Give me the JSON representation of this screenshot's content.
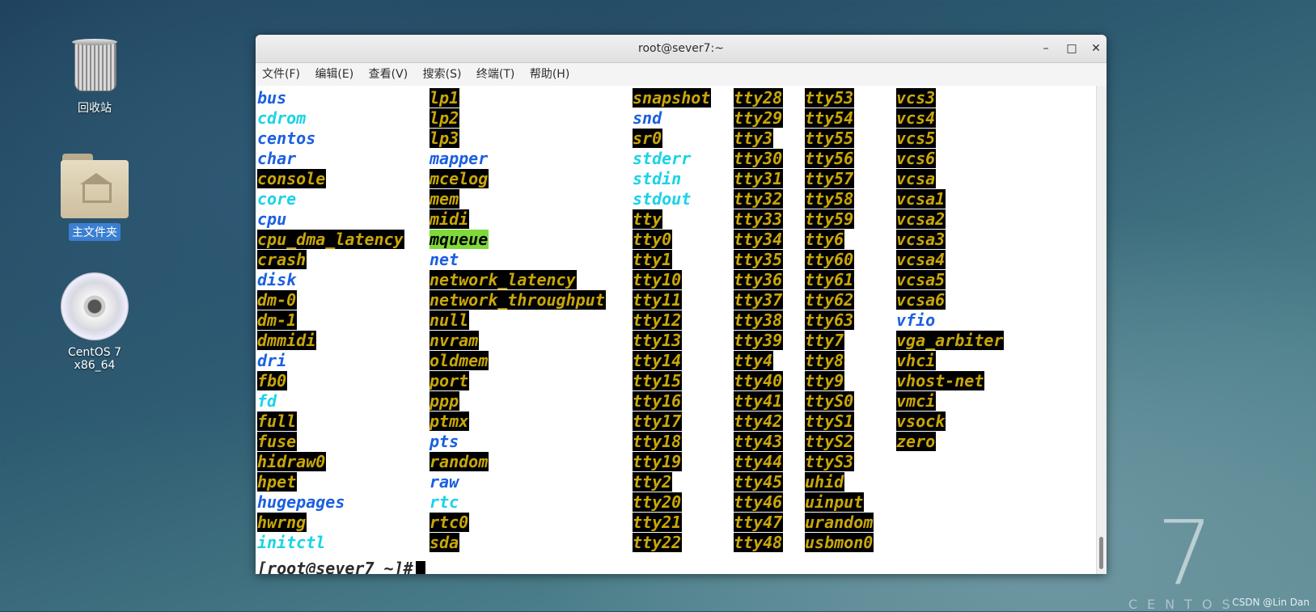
{
  "desktop": {
    "icons": [
      {
        "label": "回收站",
        "icon": "trash-icon"
      },
      {
        "label": "主文件夹",
        "icon": "home-folder-icon"
      },
      {
        "label": "CentOS 7 x86_64",
        "icon": "disc-icon"
      }
    ],
    "branding": {
      "number": "7",
      "word": "CENTOS"
    },
    "watermark": "CSDN @Lin Dan"
  },
  "window": {
    "title": "root@sever7:~",
    "controls": {
      "minimize": "–",
      "maximize": "□",
      "close": "✕"
    },
    "menu": [
      "文件(F)",
      "编辑(E)",
      "查看(V)",
      "搜索(S)",
      "终端(T)",
      "帮助(H)"
    ]
  },
  "terminal": {
    "colors": {
      "dir": "#1a5fe0",
      "link": "#19d3e6",
      "device": "#c9a70a",
      "sticky_bg": "#7fd93a"
    },
    "columns": [
      [
        {
          "name": "bus",
          "type": "dir"
        },
        {
          "name": "cdrom",
          "type": "link"
        },
        {
          "name": "centos",
          "type": "dir"
        },
        {
          "name": "char",
          "type": "dir"
        },
        {
          "name": "console",
          "type": "dev"
        },
        {
          "name": "core",
          "type": "link"
        },
        {
          "name": "cpu",
          "type": "dir"
        },
        {
          "name": "cpu_dma_latency",
          "type": "dev"
        },
        {
          "name": "crash",
          "type": "dev"
        },
        {
          "name": "disk",
          "type": "dir"
        },
        {
          "name": "dm-0",
          "type": "dev"
        },
        {
          "name": "dm-1",
          "type": "dev"
        },
        {
          "name": "dmmidi",
          "type": "dev"
        },
        {
          "name": "dri",
          "type": "dir"
        },
        {
          "name": "fb0",
          "type": "dev"
        },
        {
          "name": "fd",
          "type": "link"
        },
        {
          "name": "full",
          "type": "dev"
        },
        {
          "name": "fuse",
          "type": "dev"
        },
        {
          "name": "hidraw0",
          "type": "dev"
        },
        {
          "name": "hpet",
          "type": "dev"
        },
        {
          "name": "hugepages",
          "type": "dir"
        },
        {
          "name": "hwrng",
          "type": "dev"
        },
        {
          "name": "initctl",
          "type": "link"
        }
      ],
      [
        {
          "name": "lp1",
          "type": "dev"
        },
        {
          "name": "lp2",
          "type": "dev"
        },
        {
          "name": "lp3",
          "type": "dev"
        },
        {
          "name": "mapper",
          "type": "dir"
        },
        {
          "name": "mcelog",
          "type": "dev"
        },
        {
          "name": "mem",
          "type": "dev"
        },
        {
          "name": "midi",
          "type": "dev"
        },
        {
          "name": "mqueue",
          "type": "sticky"
        },
        {
          "name": "net",
          "type": "dir"
        },
        {
          "name": "network_latency",
          "type": "dev"
        },
        {
          "name": "network_throughput",
          "type": "dev"
        },
        {
          "name": "null",
          "type": "dev"
        },
        {
          "name": "nvram",
          "type": "dev"
        },
        {
          "name": "oldmem",
          "type": "dev"
        },
        {
          "name": "port",
          "type": "dev"
        },
        {
          "name": "ppp",
          "type": "dev"
        },
        {
          "name": "ptmx",
          "type": "dev"
        },
        {
          "name": "pts",
          "type": "dir"
        },
        {
          "name": "random",
          "type": "dev"
        },
        {
          "name": "raw",
          "type": "dir"
        },
        {
          "name": "rtc",
          "type": "link"
        },
        {
          "name": "rtc0",
          "type": "dev"
        },
        {
          "name": "sda",
          "type": "dev"
        }
      ],
      [
        {
          "name": "snapshot",
          "type": "dev"
        },
        {
          "name": "snd",
          "type": "dir"
        },
        {
          "name": "sr0",
          "type": "dev"
        },
        {
          "name": "stderr",
          "type": "link"
        },
        {
          "name": "stdin",
          "type": "link"
        },
        {
          "name": "stdout",
          "type": "link"
        },
        {
          "name": "tty",
          "type": "dev"
        },
        {
          "name": "tty0",
          "type": "dev"
        },
        {
          "name": "tty1",
          "type": "dev"
        },
        {
          "name": "tty10",
          "type": "dev"
        },
        {
          "name": "tty11",
          "type": "dev"
        },
        {
          "name": "tty12",
          "type": "dev"
        },
        {
          "name": "tty13",
          "type": "dev"
        },
        {
          "name": "tty14",
          "type": "dev"
        },
        {
          "name": "tty15",
          "type": "dev"
        },
        {
          "name": "tty16",
          "type": "dev"
        },
        {
          "name": "tty17",
          "type": "dev"
        },
        {
          "name": "tty18",
          "type": "dev"
        },
        {
          "name": "tty19",
          "type": "dev"
        },
        {
          "name": "tty2",
          "type": "dev"
        },
        {
          "name": "tty20",
          "type": "dev"
        },
        {
          "name": "tty21",
          "type": "dev"
        },
        {
          "name": "tty22",
          "type": "dev"
        }
      ],
      [
        {
          "name": "tty28",
          "type": "dev"
        },
        {
          "name": "tty29",
          "type": "dev"
        },
        {
          "name": "tty3",
          "type": "dev"
        },
        {
          "name": "tty30",
          "type": "dev"
        },
        {
          "name": "tty31",
          "type": "dev"
        },
        {
          "name": "tty32",
          "type": "dev"
        },
        {
          "name": "tty33",
          "type": "dev"
        },
        {
          "name": "tty34",
          "type": "dev"
        },
        {
          "name": "tty35",
          "type": "dev"
        },
        {
          "name": "tty36",
          "type": "dev"
        },
        {
          "name": "tty37",
          "type": "dev"
        },
        {
          "name": "tty38",
          "type": "dev"
        },
        {
          "name": "tty39",
          "type": "dev"
        },
        {
          "name": "tty4",
          "type": "dev"
        },
        {
          "name": "tty40",
          "type": "dev"
        },
        {
          "name": "tty41",
          "type": "dev"
        },
        {
          "name": "tty42",
          "type": "dev"
        },
        {
          "name": "tty43",
          "type": "dev"
        },
        {
          "name": "tty44",
          "type": "dev"
        },
        {
          "name": "tty45",
          "type": "dev"
        },
        {
          "name": "tty46",
          "type": "dev"
        },
        {
          "name": "tty47",
          "type": "dev"
        },
        {
          "name": "tty48",
          "type": "dev"
        }
      ],
      [
        {
          "name": "tty53",
          "type": "dev"
        },
        {
          "name": "tty54",
          "type": "dev"
        },
        {
          "name": "tty55",
          "type": "dev"
        },
        {
          "name": "tty56",
          "type": "dev"
        },
        {
          "name": "tty57",
          "type": "dev"
        },
        {
          "name": "tty58",
          "type": "dev"
        },
        {
          "name": "tty59",
          "type": "dev"
        },
        {
          "name": "tty6",
          "type": "dev"
        },
        {
          "name": "tty60",
          "type": "dev"
        },
        {
          "name": "tty61",
          "type": "dev"
        },
        {
          "name": "tty62",
          "type": "dev"
        },
        {
          "name": "tty63",
          "type": "dev"
        },
        {
          "name": "tty7",
          "type": "dev"
        },
        {
          "name": "tty8",
          "type": "dev"
        },
        {
          "name": "tty9",
          "type": "dev"
        },
        {
          "name": "ttyS0",
          "type": "dev"
        },
        {
          "name": "ttyS1",
          "type": "dev"
        },
        {
          "name": "ttyS2",
          "type": "dev"
        },
        {
          "name": "ttyS3",
          "type": "dev"
        },
        {
          "name": "uhid",
          "type": "dev"
        },
        {
          "name": "uinput",
          "type": "dev"
        },
        {
          "name": "urandom",
          "type": "dev"
        },
        {
          "name": "usbmon0",
          "type": "dev"
        }
      ],
      [
        {
          "name": "vcs3",
          "type": "dev"
        },
        {
          "name": "vcs4",
          "type": "dev"
        },
        {
          "name": "vcs5",
          "type": "dev"
        },
        {
          "name": "vcs6",
          "type": "dev"
        },
        {
          "name": "vcsa",
          "type": "dev"
        },
        {
          "name": "vcsa1",
          "type": "dev"
        },
        {
          "name": "vcsa2",
          "type": "dev"
        },
        {
          "name": "vcsa3",
          "type": "dev"
        },
        {
          "name": "vcsa4",
          "type": "dev"
        },
        {
          "name": "vcsa5",
          "type": "dev"
        },
        {
          "name": "vcsa6",
          "type": "dev"
        },
        {
          "name": "vfio",
          "type": "dir"
        },
        {
          "name": "vga_arbiter",
          "type": "dev"
        },
        {
          "name": "vhci",
          "type": "dev"
        },
        {
          "name": "vhost-net",
          "type": "dev"
        },
        {
          "name": "vmci",
          "type": "dev"
        },
        {
          "name": "vsock",
          "type": "dev"
        },
        {
          "name": "zero",
          "type": "dev"
        }
      ]
    ],
    "prompt": "[root@sever7 ~]#"
  }
}
